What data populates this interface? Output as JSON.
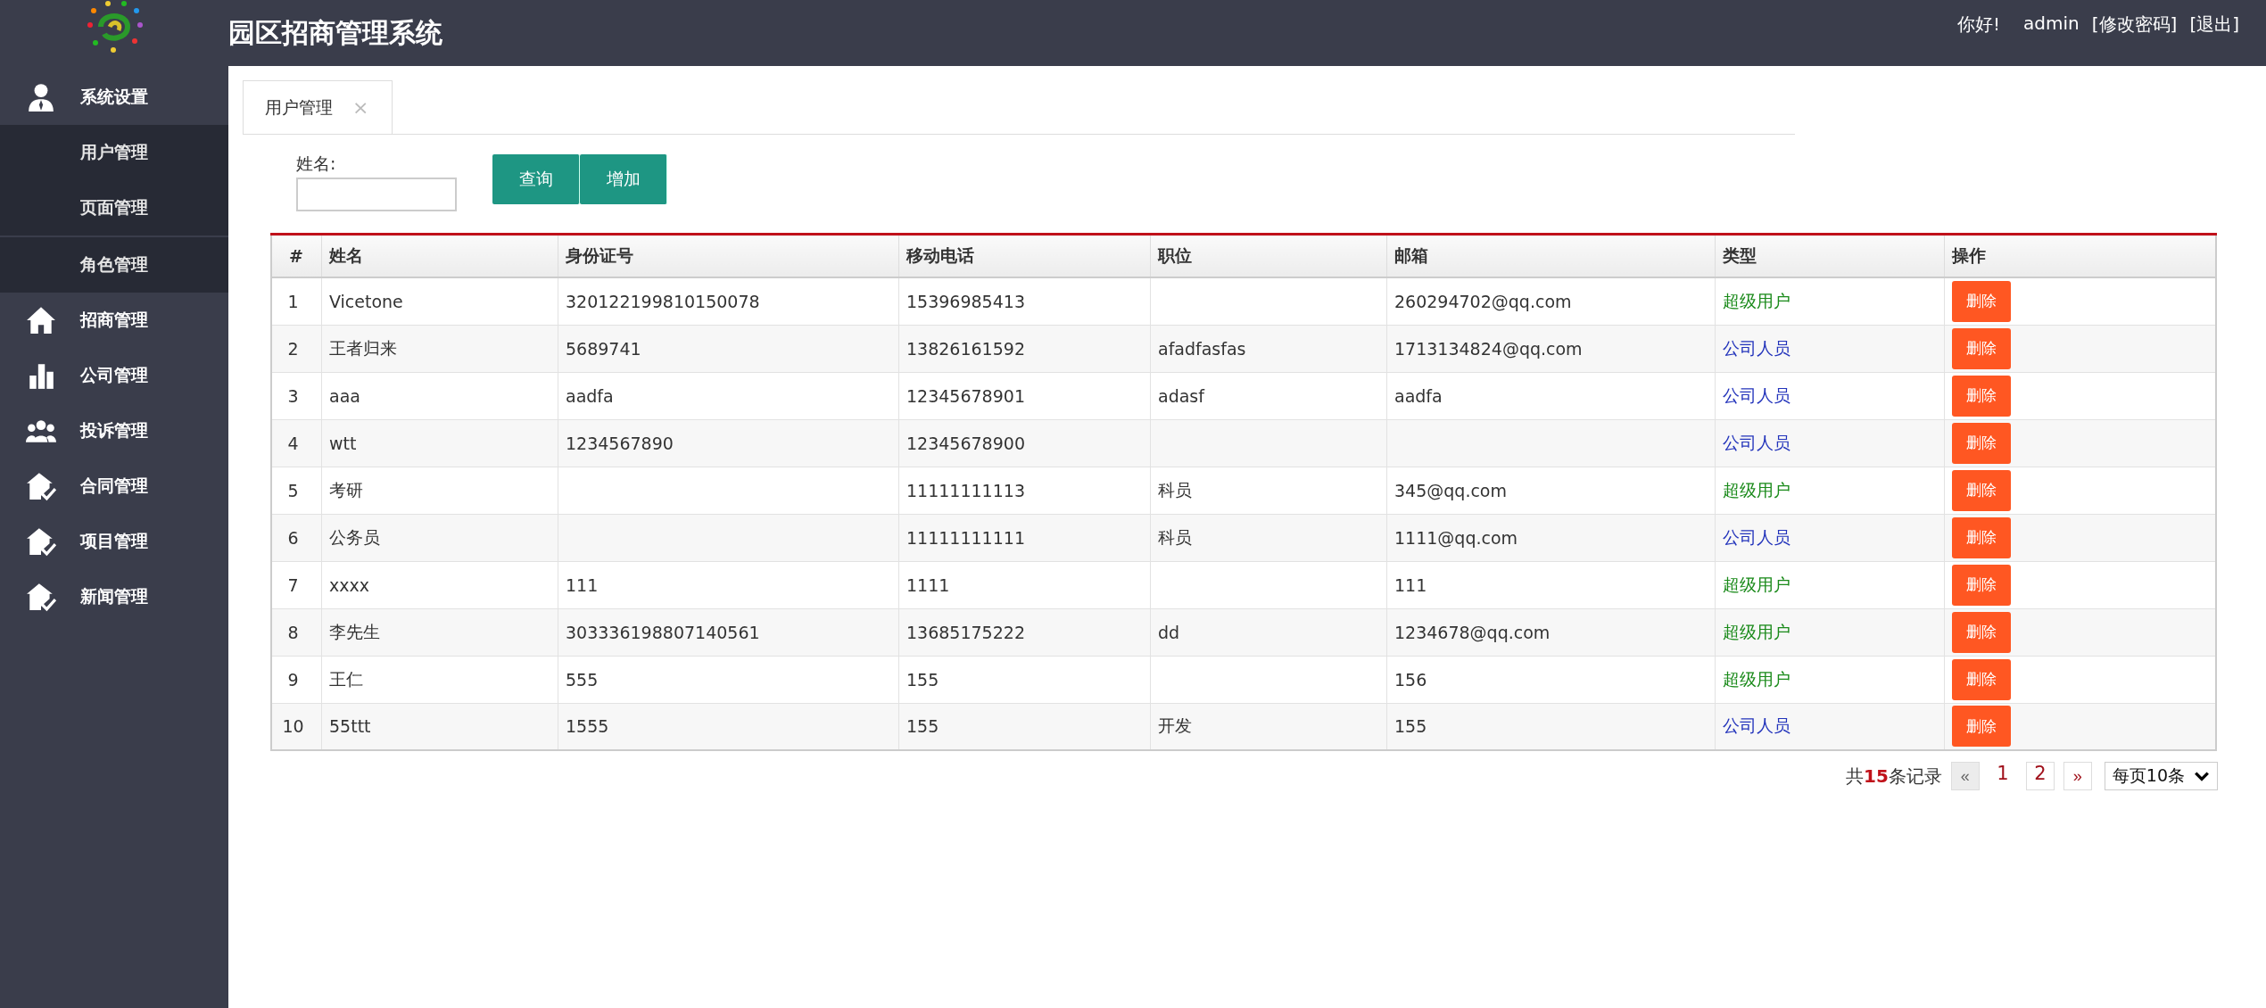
{
  "header": {
    "title": "园区招商管理系统",
    "greeting": "你好!",
    "username": "admin",
    "links": [
      "[修改密码]",
      "[退出]"
    ]
  },
  "sidebar": {
    "items": [
      {
        "label": "系统设置",
        "kind": "user",
        "children": [
          {
            "label": "用户管理"
          },
          {
            "label": "页面管理"
          },
          {
            "label": "角色管理"
          }
        ]
      },
      {
        "label": "招商管理",
        "kind": "home"
      },
      {
        "label": "公司管理",
        "kind": "chart"
      },
      {
        "label": "投诉管理",
        "kind": "group"
      },
      {
        "label": "合同管理",
        "kind": "house"
      },
      {
        "label": "项目管理",
        "kind": "house"
      },
      {
        "label": "新闻管理",
        "kind": "house"
      }
    ]
  },
  "tabs": [
    {
      "label": "用户管理",
      "close": "×",
      "selected": true
    }
  ],
  "search": {
    "label": "姓名:",
    "buttons": [
      "查询",
      "增加"
    ]
  },
  "table": {
    "columns": [
      "#",
      "姓名",
      "身份证号",
      "移动电话",
      "职位",
      "邮箱",
      "类型",
      "操作"
    ],
    "rows": [
      {
        "no": "1",
        "name": "Vicetone",
        "id": "320122199810150078",
        "phone": "15396985413",
        "position": "",
        "email": "260294702@qq.com",
        "type": "超级用户",
        "color": "#1a8a1a",
        "action": "删除"
      },
      {
        "no": "2",
        "name": "王者归来",
        "id": "5689741",
        "phone": "13826161592",
        "position": "afadfasfas",
        "email": "1713134824@qq.com",
        "type": "公司人员",
        "color": "#2233bb",
        "action": "删除"
      },
      {
        "no": "3",
        "name": "aaa",
        "id": "aadfa",
        "phone": "12345678901",
        "position": "adasf",
        "email": "aadfa",
        "type": "公司人员",
        "color": "#2233bb",
        "action": "删除"
      },
      {
        "no": "4",
        "name": "wtt",
        "id": "1234567890",
        "phone": "12345678900",
        "position": "",
        "email": "",
        "type": "公司人员",
        "color": "#2233bb",
        "action": "删除"
      },
      {
        "no": "5",
        "name": "考研",
        "id": "",
        "phone": "11111111113",
        "position": "科员",
        "email": "345@qq.com",
        "type": "超级用户",
        "color": "#1a8a1a",
        "action": "删除"
      },
      {
        "no": "6",
        "name": "公务员",
        "id": "",
        "phone": "11111111111",
        "position": "科员",
        "email": "1111@qq.com",
        "type": "公司人员",
        "color": "#2233bb",
        "action": "删除"
      },
      {
        "no": "7",
        "name": "xxxx",
        "id": "111",
        "phone": "1111",
        "position": "",
        "email": "111",
        "type": "超级用户",
        "color": "#1a8a1a",
        "action": "删除"
      },
      {
        "no": "8",
        "name": "李先生",
        "id": "303336198807140561",
        "phone": "13685175222",
        "position": "dd",
        "email": "1234678@qq.com",
        "type": "超级用户",
        "color": "#1a8a1a",
        "action": "删除"
      },
      {
        "no": "9",
        "name": "王仁",
        "id": "555",
        "phone": "155",
        "position": "",
        "email": "156",
        "type": "超级用户",
        "color": "#1a8a1a",
        "action": "删除"
      },
      {
        "no": "10",
        "name": "55ttt",
        "id": "1555",
        "phone": "155",
        "position": "开发",
        "email": "155",
        "type": "公司人员",
        "color": "#2233bb",
        "action": "删除"
      }
    ]
  },
  "pagination": {
    "total": "共**15**条记录",
    "prev": {
      "label": "«",
      "disabled": true
    },
    "pages": [
      {
        "label": "1",
        "selected": true
      },
      {
        "label": "2",
        "selected": false
      }
    ],
    "next": {
      "label": "»",
      "disabled": false
    },
    "page_size": "每页10条"
  }
}
